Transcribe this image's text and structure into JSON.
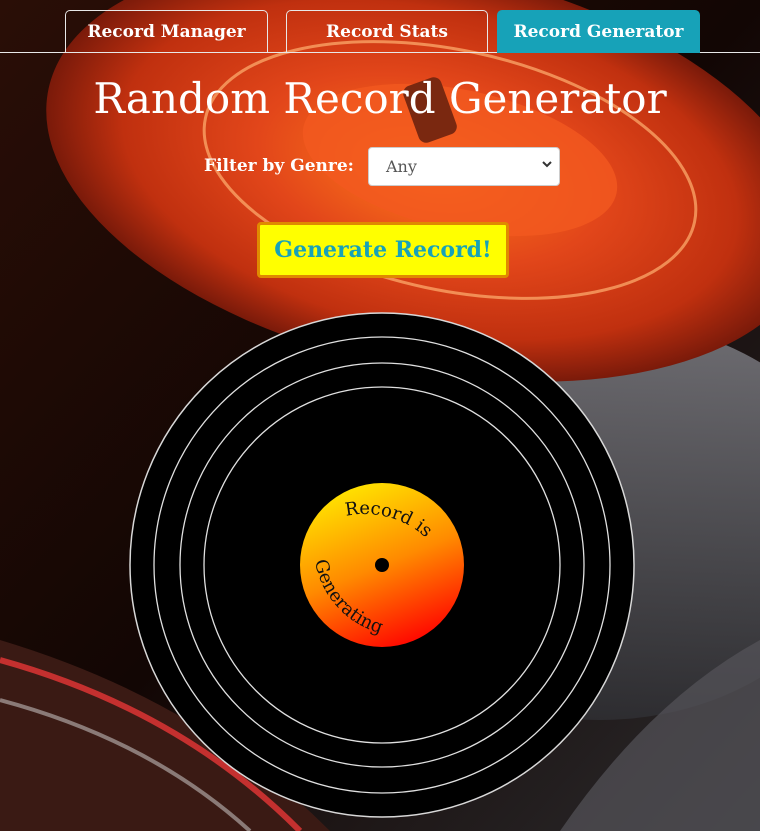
{
  "tabs": [
    {
      "label": "Record Manager",
      "active": false
    },
    {
      "label": "Record Stats",
      "active": false
    },
    {
      "label": "Record Generator",
      "active": true
    }
  ],
  "page": {
    "title": "Random Record Generator"
  },
  "filter": {
    "label": "Filter by Genre:",
    "selected": "Any"
  },
  "generate_button": {
    "label": "Generate Record!"
  },
  "record": {
    "label_line1": "Record is",
    "label_line2": "Generating"
  },
  "colors": {
    "accent": "#17a2b8",
    "button_bg": "#ffff00",
    "button_border": "#e08a00",
    "label_gradient_top": "#ffe600",
    "label_gradient_bottom": "#ff0000"
  }
}
